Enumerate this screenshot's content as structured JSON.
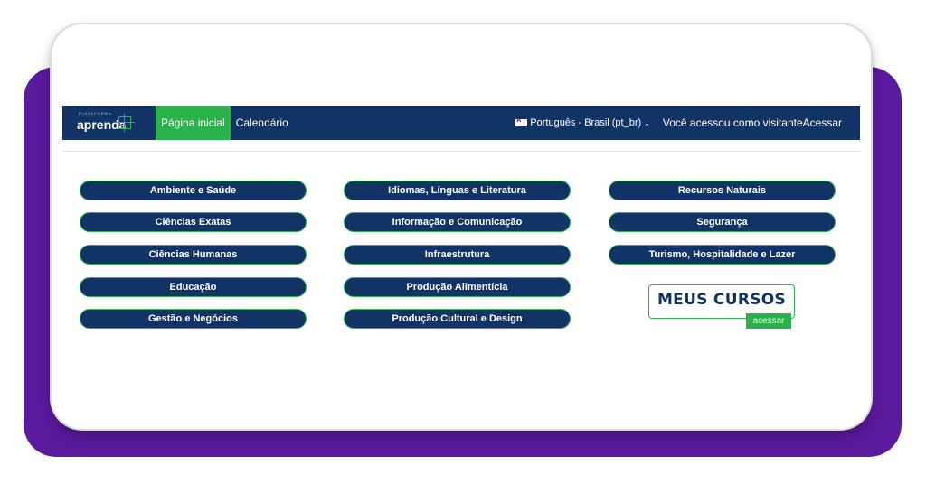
{
  "nav": {
    "logo_small": "PLATAFORMA",
    "logo_text": "aprenda",
    "items": [
      {
        "label": "Página inicial",
        "active": true
      },
      {
        "label": "Calendário",
        "active": false
      }
    ],
    "language": "Português - Brasil (pt_br)",
    "login_status": "Você acessou como visitante",
    "login_link": "Acessar"
  },
  "areas": {
    "col1": [
      "Ambiente e Saúde",
      "Ciências Exatas",
      "Ciências Humanas",
      "Educação",
      "Gestão e Negócios"
    ],
    "col2": [
      "Idiomas, Línguas e Literatura",
      "Informação e Comunicação",
      "Infraestrutura",
      "Produção Alimentícia",
      "Produção Cultural e Design"
    ],
    "col3": [
      "Recursos Naturais",
      "Segurança",
      "Turismo, Hospitalidade e Lazer"
    ]
  },
  "meus_cursos": {
    "title": "MEUS CURSOS",
    "subtitle": "acessar"
  },
  "colors": {
    "navy": "#123366",
    "green": "#2bb24c",
    "purple": "#5b1a9e"
  }
}
